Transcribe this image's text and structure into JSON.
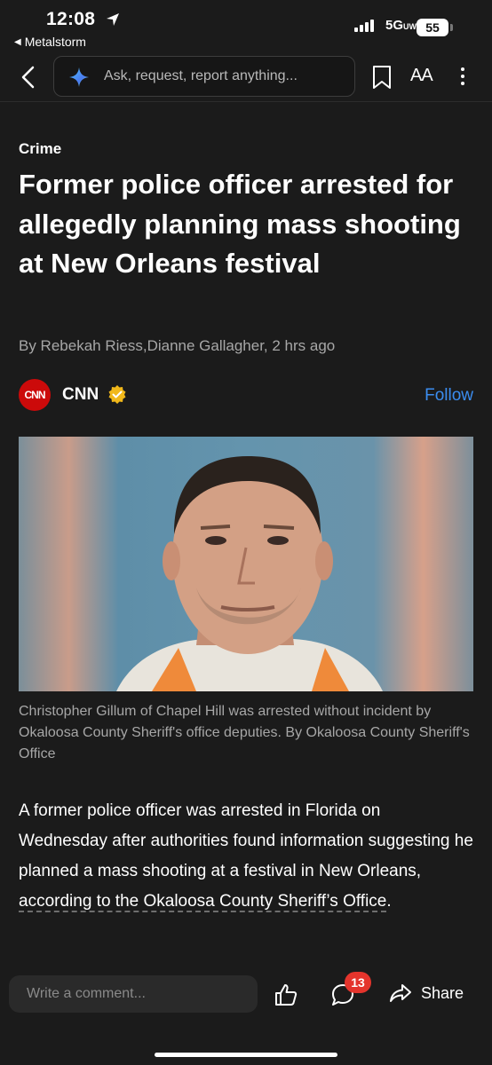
{
  "status_bar": {
    "time": "12:08",
    "back_app": "Metalstorm",
    "network": "5G",
    "network_sub": "UW",
    "battery": "55"
  },
  "topnav": {
    "search_placeholder": "Ask, request, report anything...",
    "text_size_label": "AA"
  },
  "article": {
    "category": "Crime",
    "headline": "Former police officer arrested for allegedly planning mass shooting at New Orleans festival",
    "byline": "By Rebekah Riess,Dianne Gallagher,  2 hrs ago",
    "source": {
      "logo_text": "CNN",
      "name": "CNN",
      "verified": true,
      "follow_label": "Follow",
      "follow_color": "#3b8df0"
    },
    "photo_caption": "Christopher Gillum of Chapel Hill was arrested without incident by Okaloosa County Sheriff's office deputies. By Okaloosa County Sheriff's Office",
    "body_intro": "A former police officer was arrested in Florida on Wednesday after authorities found information suggesting he planned a mass shooting at a festival in New Orleans, ",
    "body_link": "according to the Okaloosa County Sheriff’s Office",
    "body_end": "."
  },
  "bottom_bar": {
    "comment_placeholder": "Write a comment...",
    "comment_count": "13",
    "share_label": "Share",
    "badge_color": "#e4342c"
  },
  "icons": [
    "back-chevron",
    "sparkle-copilot",
    "bookmark",
    "text-size",
    "more-vertical",
    "verified-badge",
    "thumbs-up",
    "comment-bubble",
    "share-arrow"
  ]
}
